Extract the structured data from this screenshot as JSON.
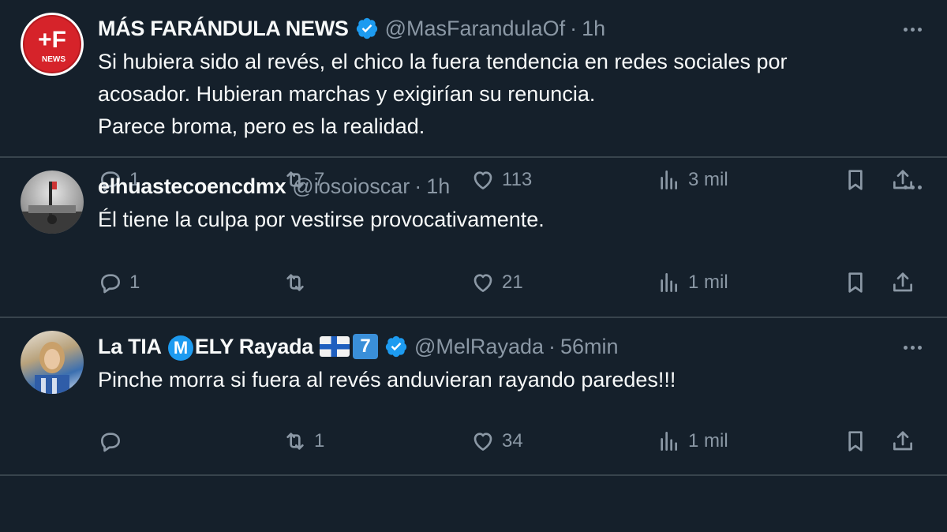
{
  "tweets": [
    {
      "name": "MÁS FARÁNDULA NEWS",
      "verified": true,
      "handle": "@MasFarandulaOf",
      "dot": "·",
      "time": "1h",
      "avatar_label": "+F",
      "avatar_sub": "NEWS",
      "text": [
        "Si hubiera sido al revés, el chico la fuera tendencia en redes sociales por",
        "acosador. Hubieran marchas y exigirían su renuncia.",
        "Parece broma, pero es la realidad."
      ],
      "replies": "1",
      "retweets": "7",
      "likes": "113",
      "views": "3 mil"
    },
    {
      "name": "elhuastecoencdmx",
      "verified": false,
      "handle": "@iosoioscar",
      "dot": "·",
      "time": "1h",
      "text": [
        "Él tiene la culpa por vestirse provocativamente."
      ],
      "replies": "1",
      "retweets": "",
      "likes": "21",
      "views": "1 mil"
    },
    {
      "name_part1": "La TIA ",
      "name_emblem": "M",
      "name_part2": "ELY Rayada",
      "name_keycap": "7",
      "verified": true,
      "handle": "@MelRayada",
      "dot": "·",
      "time": "56min",
      "text": [
        "Pinche morra si fuera al revés anduvieran rayando paredes!!!"
      ],
      "replies": "",
      "retweets": "1",
      "likes": "34",
      "views": "1 mil"
    }
  ],
  "colors": {
    "background": "#15202b",
    "text": "#f7f9f9",
    "muted": "#8b98a5",
    "verified": "#1d9bf0",
    "divider": "#38444d"
  }
}
